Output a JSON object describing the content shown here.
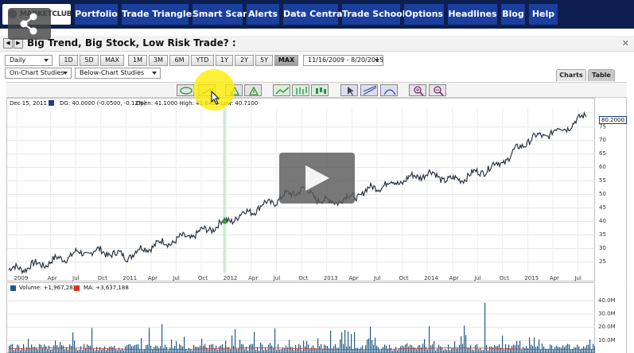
{
  "nav": {
    "logo": "MARKETCLUB",
    "items": [
      "Portfolio",
      "Trade Triangles",
      "Smart Scan",
      "Alerts",
      "Data Central",
      "Trade School",
      "Options",
      "Headlines",
      "Blog",
      "Help"
    ]
  },
  "title_bar": {
    "prev": "◀",
    "next": "▶",
    "title": "Big Trend, Big Stock, Low Risk Trade? :",
    "corner": "✕"
  },
  "toolbar": {
    "interval": "Daily",
    "ranges": [
      "1D",
      "5D",
      "MAX",
      "1M",
      "3M",
      "6M",
      "YTD",
      "1Y",
      "2Y",
      "5Y",
      "MAX"
    ],
    "active_range": "MAX",
    "date_range": "11/16/2009 - 8/20/2015",
    "on_chart_studies": "On-Chart Studies",
    "below_chart_studies": "Below-Chart Studies"
  },
  "tabs": {
    "charts": "Charts",
    "table": "Table"
  },
  "tools": [
    "comment-icon",
    "trend-line-icon",
    "triangle-up-icon",
    "triangle-down-icon",
    "line-chart-icon",
    "bar-chart-icon",
    "candle-icon",
    "pointer-icon",
    "draw-line-icon",
    "arc-icon",
    "zoom-in-icon",
    "zoom-out-icon"
  ],
  "price_legend": {
    "date": "Dec 15, 2011",
    "symbol": "DG: 40.0000 (-0.0500, -0.12%)",
    "ohl": "Open: 41.1000  High: 41.6400  Low: 40.7100"
  },
  "volume_legend": {
    "volume": "Volume: +1,967,282",
    "ma": "MA: +3,637,188"
  },
  "last_price": "80.2000",
  "colors": {
    "nav_bg": "#0d1f4f",
    "nav_button": "#1b3f9e",
    "price_line": "#2b3542",
    "volume_bar": "#1f5b88",
    "ma_line": "#d9341f",
    "marker": "#3aa83a"
  },
  "chart_data": [
    {
      "type": "line",
      "title": "DG",
      "x": [
        "2009-11",
        "2010-01",
        "2010-04",
        "2010-07",
        "2010-10",
        "2011-01",
        "2011-04",
        "2011-07",
        "2011-10",
        "2012-01",
        "2012-04",
        "2012-07",
        "2012-10",
        "2013-01",
        "2013-04",
        "2013-07",
        "2013-10",
        "2014-01",
        "2014-04",
        "2014-07",
        "2014-10",
        "2015-01",
        "2015-04",
        "2015-07",
        "2015-08"
      ],
      "series": [
        {
          "values": [
            22,
            23,
            25,
            28,
            29,
            27,
            31,
            33,
            36,
            40,
            44,
            48,
            52,
            47,
            49,
            53,
            55,
            58,
            55,
            58,
            62,
            70,
            73,
            77,
            80.2
          ]
        }
      ],
      "x_tick_labels": [
        "2009",
        "Apr",
        "Jul",
        "Oct",
        "2011",
        "Apr",
        "Jul",
        "Oct",
        "2012",
        "Apr",
        "Jul",
        "Oct",
        "2013",
        "Apr",
        "Jul",
        "Oct",
        "2014",
        "Apr",
        "Jul",
        "Oct",
        "2015",
        "Apr",
        "Jul"
      ],
      "y_tick_labels": [
        "25",
        "30",
        "35",
        "40",
        "45",
        "50",
        "55",
        "60",
        "65",
        "70",
        "75"
      ],
      "ylim": [
        21,
        82
      ],
      "grid": true,
      "highlight_date": "Dec 15, 2011",
      "highlight_value": 40.0
    },
    {
      "type": "bar",
      "series_legend": [
        "Volume",
        "MA"
      ],
      "y_tick_labels": [
        "10.0M",
        "20.0M",
        "30.0M",
        "40.0M"
      ],
      "ylim": [
        0,
        45000000
      ],
      "grid": true,
      "peak_volume_millions": 38.5
    }
  ]
}
